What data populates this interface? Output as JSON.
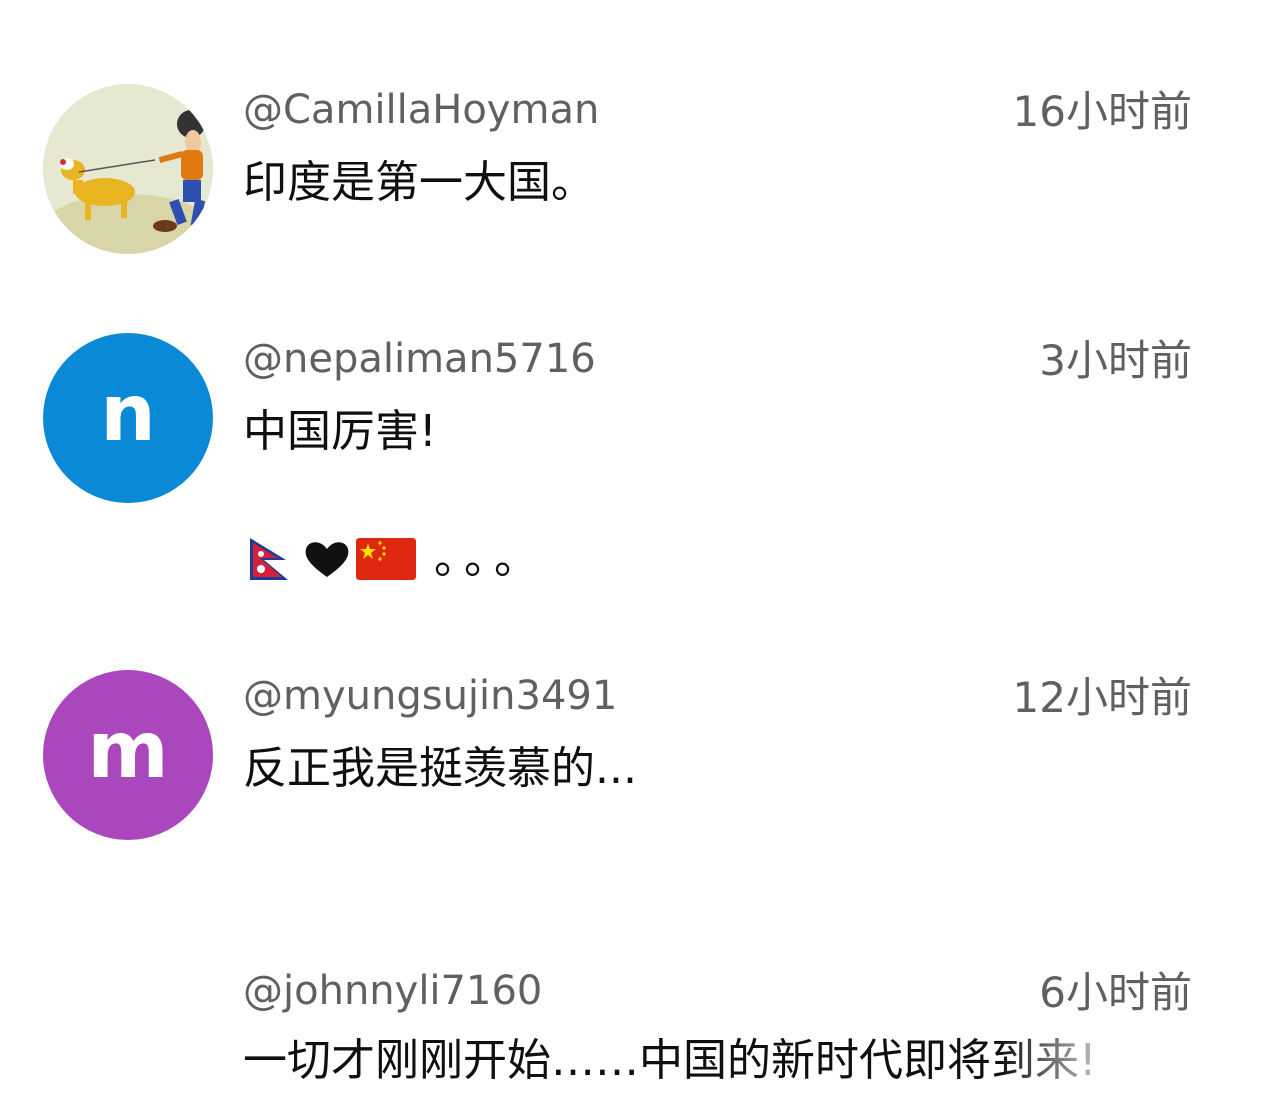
{
  "comments": [
    {
      "handle": "@CamillaHoyman",
      "time": "16小时前",
      "text": "印度是第一大国。",
      "avatar_icon": "goofy-pluto-cartoon-avatar"
    },
    {
      "handle": "@nepaliman5716",
      "time": "3小时前",
      "text": "中国厉害!",
      "text_line2_suffix": "。。。",
      "avatar_letter": "n",
      "avatar_color": "#0a8ad6",
      "emojis": [
        "nepal-flag-icon",
        "black-heart-icon",
        "china-flag-icon"
      ]
    },
    {
      "handle": "@myungsujin3491",
      "time": "12小时前",
      "text": "反正我是挺羡慕的...",
      "avatar_letter": "m",
      "avatar_color": "#ab47bc"
    },
    {
      "handle": "@johnnyli7160",
      "time": "6小时前",
      "text": "一切才刚刚开始……中国的新时代即将到来!"
    }
  ],
  "colors": {
    "secondary_text": "#606060",
    "primary_text": "#0f0f0f"
  }
}
